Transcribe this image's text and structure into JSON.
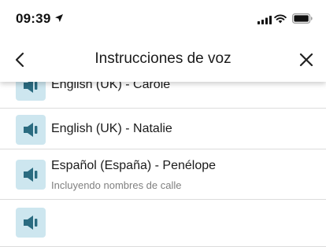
{
  "status_bar": {
    "time": "09:39",
    "icons": [
      "location-arrow-icon",
      "cellular-signal-icon",
      "wifi-icon",
      "battery-icon"
    ]
  },
  "header": {
    "title": "Instrucciones de voz",
    "back_icon": "chevron-left-icon",
    "close_icon": "close-icon"
  },
  "voices": [
    {
      "label": "English (UK) - Carole",
      "subtitle": ""
    },
    {
      "label": "English (UK) - Natalie",
      "subtitle": ""
    },
    {
      "label": "Español (España) - Penélope",
      "subtitle": "Incluyendo nombres de calle"
    },
    {
      "label": "",
      "subtitle": ""
    }
  ],
  "colors": {
    "speaker_tile": "#cde6ef",
    "speaker_glyph": "#2a6b80",
    "divider": "#dcdcdc",
    "subtitle": "#808080"
  }
}
